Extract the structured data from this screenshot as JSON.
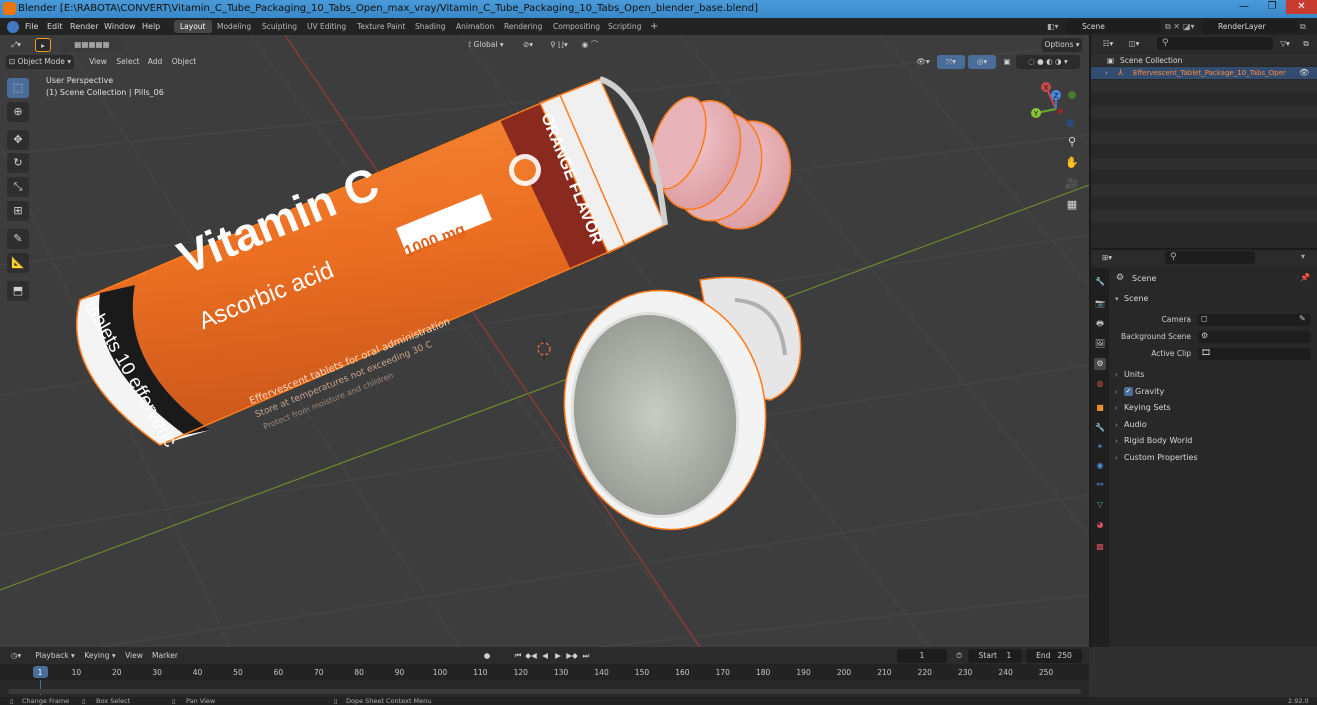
{
  "window": {
    "title": "Blender [E:\\RABOTA\\CONVERT\\Vitamin_C_Tube_Packaging_10_Tabs_Open_max_vray/Vitamin_C_Tube_Packaging_10_Tabs_Open_blender_base.blend]",
    "minimize": "—",
    "maximize": "❐",
    "close": "✕"
  },
  "menu": {
    "items": [
      "File",
      "Edit",
      "Render",
      "Window",
      "Help"
    ]
  },
  "workspaces": [
    "Layout",
    "Modeling",
    "Sculpting",
    "UV Editing",
    "Texture Paint",
    "Shading",
    "Animation",
    "Rendering",
    "Compositing",
    "Scripting"
  ],
  "workspace_add": "+",
  "scene_field": "Scene",
  "renderlayer_field": "RenderLayer",
  "viewport": {
    "mode": "Object Mode",
    "menus": [
      "View",
      "Select",
      "Add",
      "Object"
    ],
    "transform_orientation": "Global",
    "options": "Options",
    "overlay_title": "User Perspective",
    "overlay_subtitle": "(1) Scene Collection | Pills_06",
    "gizmo_labels": {
      "x": "X",
      "y": "Y",
      "z": "Z"
    }
  },
  "product_label": {
    "title": "Vitamin C",
    "subtitle": "Ascorbic acid",
    "dose": "1000 mg",
    "band_text": "tablets 10 effervenc",
    "flavor": "ORANGE FLAVOR",
    "fine_print_1": "Effervescent tablets for oral administration",
    "fine_print_2": "Store at temperatures not exceeding 30 C",
    "fine_print_3": "Protect from moisture and children"
  },
  "outliner": {
    "collection": "Scene Collection",
    "item": "Effervescent_Tablet_Package_10_Tabs_Oper"
  },
  "properties": {
    "header": "Scene",
    "section": "Scene",
    "rows": [
      {
        "label": "Camera"
      },
      {
        "label": "Background Scene"
      },
      {
        "label": "Active Clip"
      }
    ],
    "panels": [
      "Units",
      "Gravity",
      "Keying Sets",
      "Audio",
      "Rigid Body World",
      "Custom Properties"
    ],
    "gravity_checked": true
  },
  "timeline": {
    "menus": [
      "Playback",
      "Keying",
      "View",
      "Marker"
    ],
    "current_frame": "1",
    "start_label": "Start",
    "start_value": "1",
    "end_label": "End",
    "end_value": "250",
    "ticks": [
      "1",
      "10",
      "20",
      "30",
      "40",
      "50",
      "60",
      "70",
      "80",
      "90",
      "100",
      "110",
      "120",
      "130",
      "140",
      "150",
      "160",
      "170",
      "180",
      "190",
      "200",
      "210",
      "220",
      "230",
      "240",
      "250"
    ]
  },
  "statusbar": {
    "items": [
      "Change Frame",
      "Box Select",
      "Pan View",
      "Dope Sheet Context Menu"
    ],
    "version": "2.92.0"
  },
  "colors": {
    "accent": "#4a6d99",
    "selection_outline": "#ff7a1a",
    "label_orange": "#f07a2a",
    "brand_dark_red": "#8a2a1e"
  }
}
